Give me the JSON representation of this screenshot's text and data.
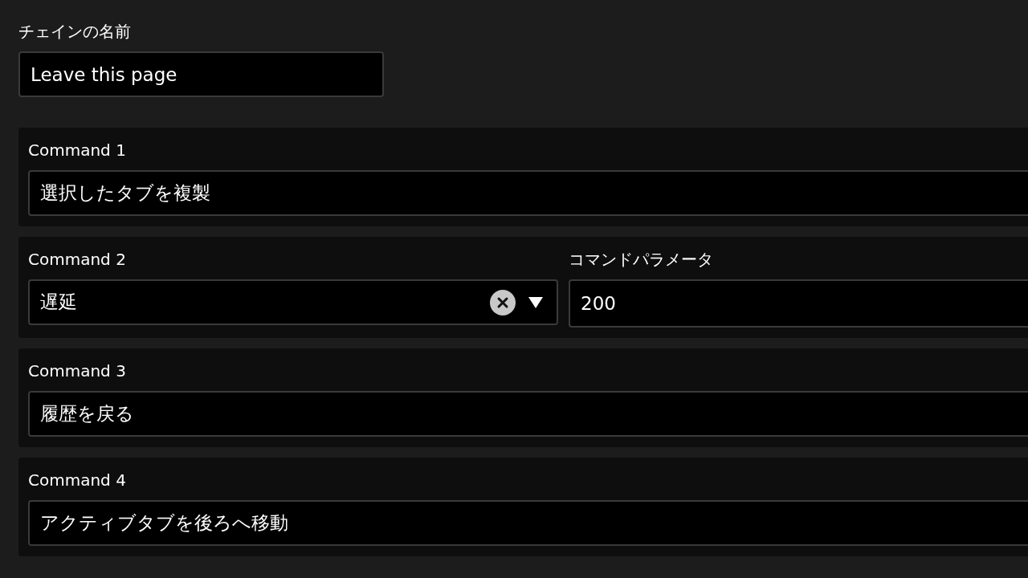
{
  "chain_name": {
    "label": "チェインの名前",
    "value": "Leave this page"
  },
  "commands": [
    {
      "kind": "plain",
      "label": "Command 1",
      "value": "選択したタブを複製"
    },
    {
      "kind": "parameter",
      "label": "Command 2",
      "value": "遅延",
      "parameter": {
        "label": "コマンドパラメータ",
        "value": "200"
      }
    },
    {
      "kind": "plain",
      "label": "Command 3",
      "value": "履歴を戻る"
    },
    {
      "kind": "plain",
      "label": "Command 4",
      "value": "アクティブタブを後ろへ移動"
    }
  ]
}
